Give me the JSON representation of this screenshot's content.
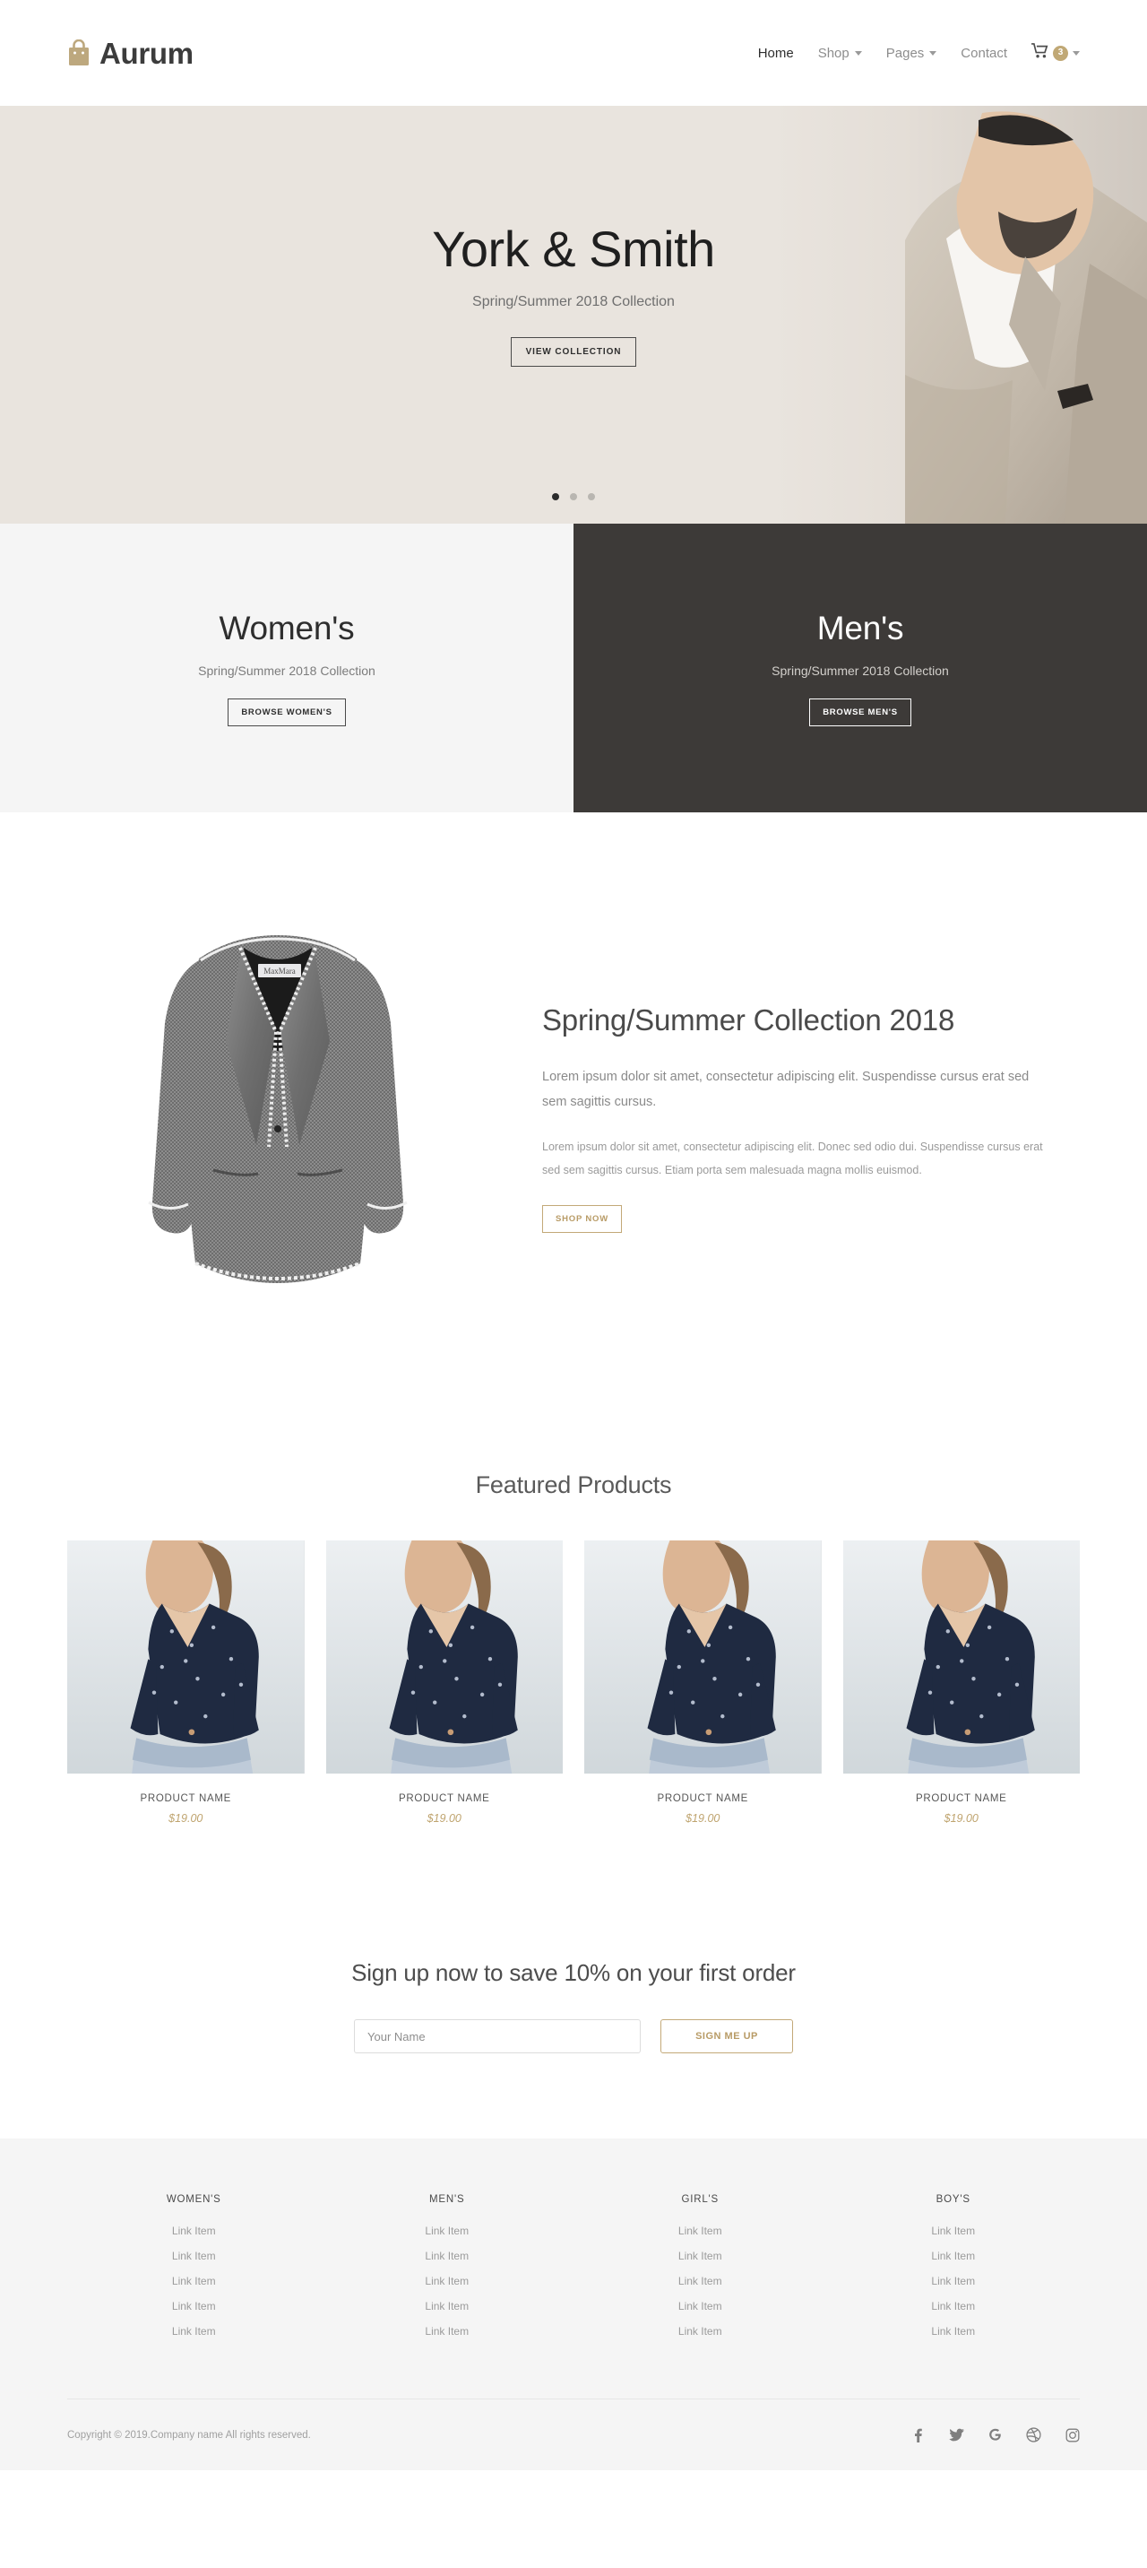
{
  "header": {
    "brand_name": "Aurum",
    "brand_icon": "shopping-bag-icon",
    "nav": [
      {
        "label": "Home",
        "has_caret": false,
        "active": true
      },
      {
        "label": "Shop",
        "has_caret": true,
        "active": false
      },
      {
        "label": "Pages",
        "has_caret": true,
        "active": false
      },
      {
        "label": "Contact",
        "has_caret": false,
        "active": false
      }
    ],
    "cart": {
      "icon": "shopping-cart-icon",
      "count": "3"
    }
  },
  "hero": {
    "title": "York & Smith",
    "subtitle": "Spring/Summer 2018 Collection",
    "cta_label": "VIEW COLLECTION",
    "dots": [
      {
        "active": true
      },
      {
        "active": false
      },
      {
        "active": false
      }
    ]
  },
  "categories": [
    {
      "title": "Women's",
      "subtitle": "Spring/Summer 2018 Collection",
      "button_label": "BROWSE WOMEN'S",
      "theme": "light"
    },
    {
      "title": "Men's",
      "subtitle": "Spring/Summer 2018 Collection",
      "button_label": "BROWSE MEN'S",
      "theme": "dark"
    }
  ],
  "collection": {
    "image_alt": "gray-blazer-product-photo",
    "title": "Spring/Summer Collection 2018",
    "lead": "Lorem ipsum dolor sit amet, consectetur adipiscing elit. Suspendisse cursus erat sed sem sagittis cursus.",
    "body": "Lorem ipsum dolor sit amet, consectetur adipiscing elit. Donec sed odio dui. Suspendisse cursus erat sed sem sagittis cursus. Etiam porta sem malesuada magna mollis euismod.",
    "cta_label": "SHOP NOW"
  },
  "featured": {
    "title": "Featured Products",
    "products": [
      {
        "name": "PRODUCT NAME",
        "price": "$19.00"
      },
      {
        "name": "PRODUCT NAME",
        "price": "$19.00"
      },
      {
        "name": "PRODUCT NAME",
        "price": "$19.00"
      },
      {
        "name": "PRODUCT NAME",
        "price": "$19.00"
      }
    ]
  },
  "newsletter": {
    "title": "Sign up now to save 10% on your first order",
    "input_value": "",
    "input_placeholder": "Your Name",
    "button_label": "SIGN ME UP"
  },
  "footer": {
    "columns": [
      {
        "title": "WOMEN'S",
        "links": [
          "Link Item",
          "Link Item",
          "Link Item",
          "Link Item",
          "Link Item"
        ]
      },
      {
        "title": "MEN'S",
        "links": [
          "Link Item",
          "Link Item",
          "Link Item",
          "Link Item",
          "Link Item"
        ]
      },
      {
        "title": "GIRL'S",
        "links": [
          "Link Item",
          "Link Item",
          "Link Item",
          "Link Item",
          "Link Item"
        ]
      },
      {
        "title": "BOY'S",
        "links": [
          "Link Item",
          "Link Item",
          "Link Item",
          "Link Item",
          "Link Item"
        ]
      }
    ],
    "copyright": "Copyright © 2019.Company name All rights reserved.",
    "social": [
      {
        "name": "facebook-icon"
      },
      {
        "name": "twitter-icon"
      },
      {
        "name": "google-icon"
      },
      {
        "name": "dribbble-icon"
      },
      {
        "name": "instagram-icon"
      }
    ]
  },
  "colors": {
    "gold": "#c0a875",
    "hero_bg": "#e9e4de",
    "dark_panel": "#3d3a38",
    "light_panel": "#f5f5f5",
    "footer_bg": "#f5f5f5"
  }
}
